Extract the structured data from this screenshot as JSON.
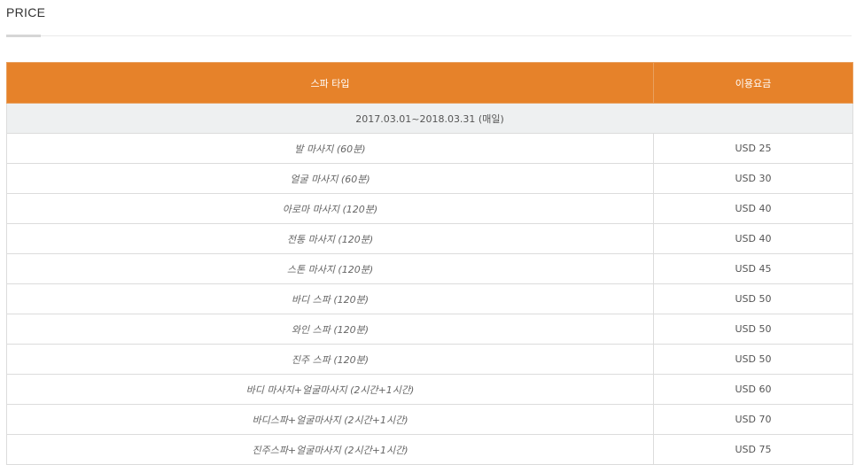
{
  "section": {
    "title": "PRICE"
  },
  "table": {
    "headers": {
      "type": "스파 타입",
      "price": "이용요금"
    },
    "period": "2017.03.01~2018.03.31 (매일)",
    "rows": [
      {
        "type": "발 마사지 (60분)",
        "price": "USD 25"
      },
      {
        "type": "얼굴 마사지 (60분)",
        "price": "USD 30"
      },
      {
        "type": "아로마 마사지 (120분)",
        "price": "USD 40"
      },
      {
        "type": "전통 마사지 (120분)",
        "price": "USD 40"
      },
      {
        "type": "스톤 마사지 (120분)",
        "price": "USD 45"
      },
      {
        "type": "바디 스파 (120분)",
        "price": "USD 50"
      },
      {
        "type": "와인 스파 (120분)",
        "price": "USD 50"
      },
      {
        "type": "진주 스파 (120분)",
        "price": "USD 50"
      },
      {
        "type": "바디 마사지+얼굴마사지 (2시간+1시간)",
        "price": "USD 60"
      },
      {
        "type": "바디스파+얼굴마사지 (2시간+1시간)",
        "price": "USD 70"
      },
      {
        "type": "진주스파+얼굴마사지 (2시간+1시간)",
        "price": "USD 75"
      }
    ]
  },
  "colors": {
    "header_bg": "#e6822a",
    "period_bg": "#eef0f1",
    "border": "#dcdcdc"
  }
}
